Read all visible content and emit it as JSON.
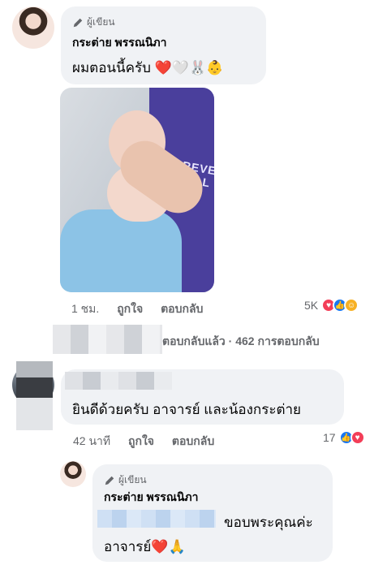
{
  "comment1": {
    "author_badge": "ผู้เขียน",
    "author_name": "กระต่าย พรรณนิภา",
    "text": "ผมตอนนี้ครับ",
    "emoji": "❤️🤍🐰👶",
    "time": "1 ชม.",
    "like_label": "ถูกใจ",
    "reply_label": "ตอบกลับ",
    "reaction_count": "5K",
    "photo_text": "FOREVER SOCIAL"
  },
  "replies_summary": {
    "text": "ตอบกลับแล้ว · 462 การตอบกลับ"
  },
  "comment2": {
    "text": "ยินดีด้วยครับ อาจารย์ และน้องกระต่าย",
    "time": "42 นาที",
    "like_label": "ถูกใจ",
    "reply_label": "ตอบกลับ",
    "reaction_count": "17"
  },
  "reply1": {
    "author_badge": "ผู้เขียน",
    "author_name": "กระต่าย พรรณนิภา",
    "text_after_tag": "ขอบพระคุณค่ะ",
    "text_line2": "อาจารย์",
    "emoji": "❤️🙏"
  },
  "colors": {
    "bubble": "#f0f2f5",
    "meta_text": "#65676b",
    "love": "#f33e58",
    "like": "#1877f2",
    "care": "#f7b125"
  }
}
